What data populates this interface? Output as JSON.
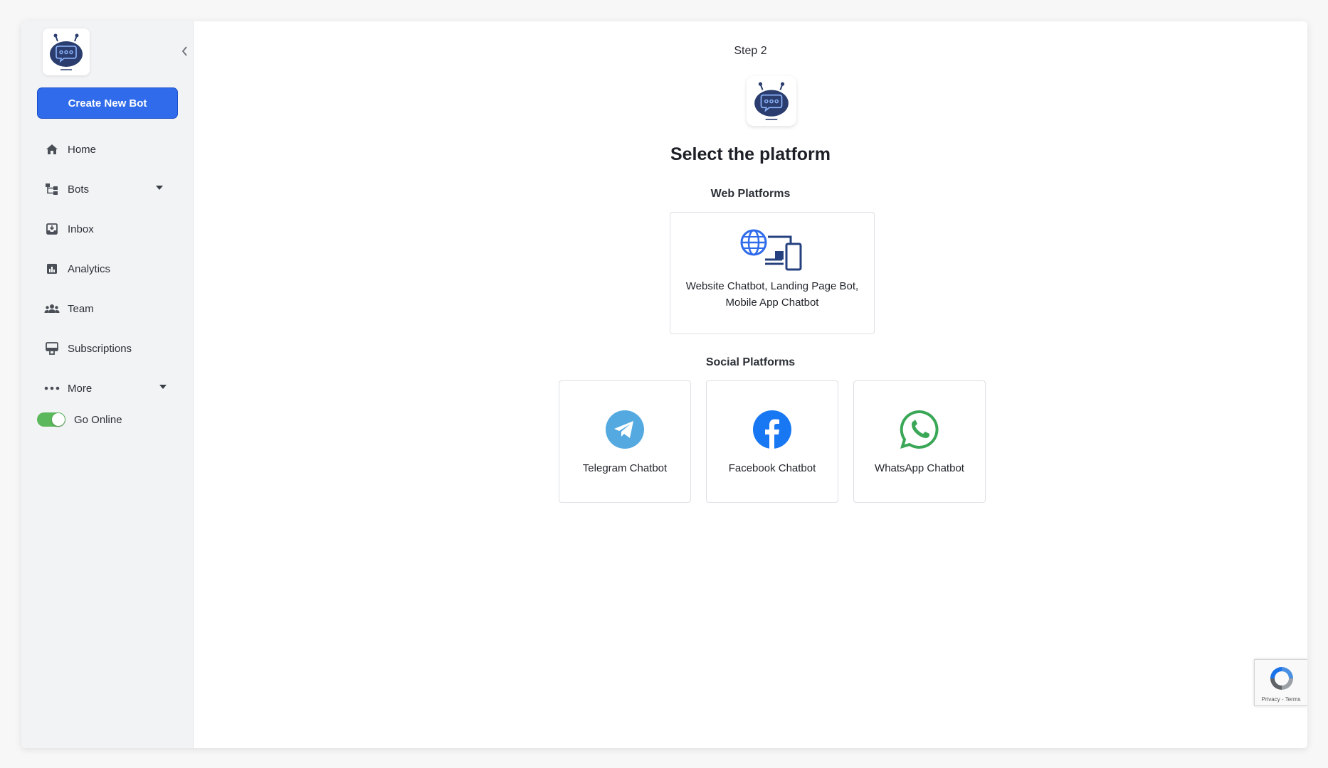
{
  "sidebar": {
    "create_button": "Create New Bot",
    "items": [
      {
        "label": "Home",
        "icon": "home-icon"
      },
      {
        "label": "Bots",
        "icon": "bots-icon"
      },
      {
        "label": "Inbox",
        "icon": "inbox-icon"
      },
      {
        "label": "Analytics",
        "icon": "analytics-icon"
      },
      {
        "label": "Team",
        "icon": "team-icon"
      },
      {
        "label": "Subscriptions",
        "icon": "subscriptions-icon"
      },
      {
        "label": "More",
        "icon": "more-icon"
      }
    ],
    "toggle_label": "Go Online",
    "toggle_on": true
  },
  "main": {
    "step": "Step 2",
    "title": "Select the platform",
    "web_section_label": "Web Platforms",
    "web_card": {
      "line1": "Website Chatbot, Landing Page Bot,",
      "line2": "Mobile App Chatbot"
    },
    "social_section_label": "Social Platforms",
    "social_cards": [
      {
        "label": "Telegram Chatbot",
        "icon": "telegram-icon"
      },
      {
        "label": "Facebook Chatbot",
        "icon": "facebook-icon"
      },
      {
        "label": "WhatsApp Chatbot",
        "icon": "whatsapp-icon"
      }
    ]
  },
  "recaptcha": {
    "links": "Privacy - Terms"
  },
  "colors": {
    "accent": "#2f6bea",
    "toggle_on": "#5cb85c",
    "telegram": "#54a9e0",
    "facebook": "#1877f2",
    "whatsapp": "#3aa757",
    "bot_navy": "#2a3d6e"
  }
}
